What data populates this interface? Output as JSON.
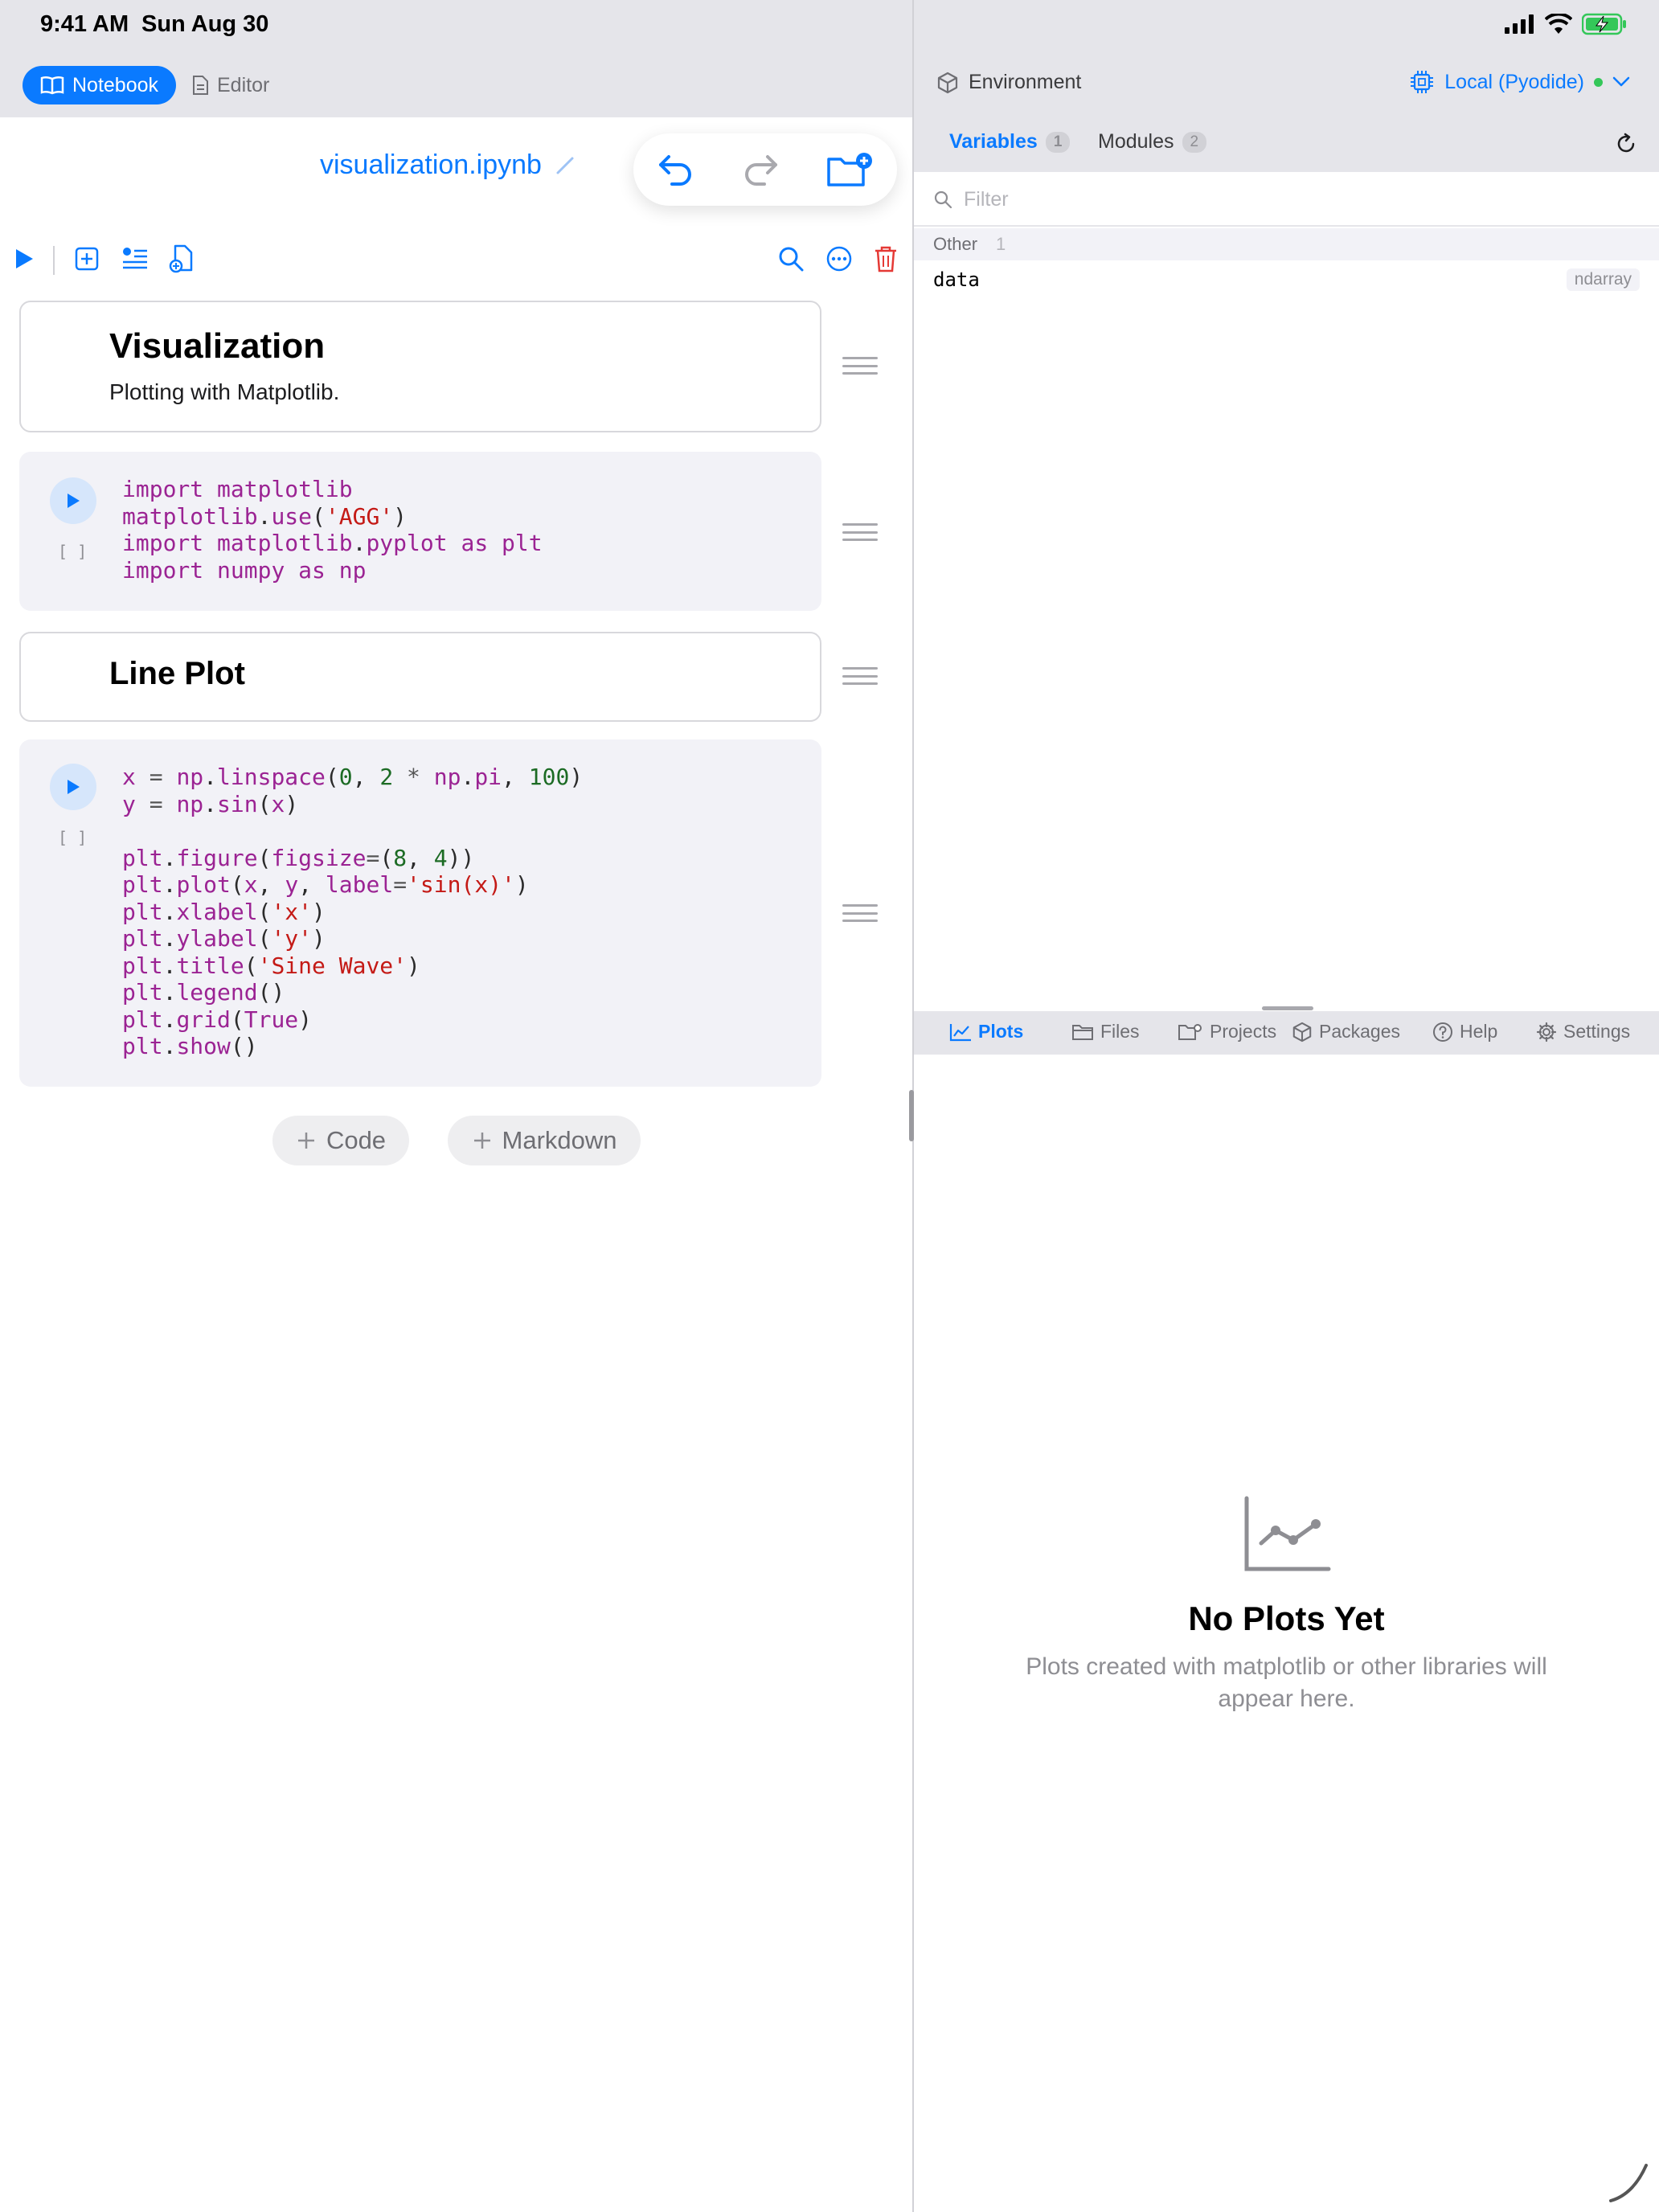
{
  "status_bar": {
    "time": "9:41 AM",
    "date": "Sun Aug 30"
  },
  "left_header": {
    "notebook_label": "Notebook",
    "editor_label": "Editor"
  },
  "notebook": {
    "filename": "visualization.ipynb"
  },
  "cells": {
    "md1": {
      "heading": "Visualization",
      "text": "Plotting with Matplotlib."
    },
    "code1": {
      "exec": "[ ]"
    },
    "md2": {
      "heading": "Line Plot"
    },
    "code2": {
      "exec": "[ ]"
    }
  },
  "add_buttons": {
    "code": "Code",
    "markdown": "Markdown"
  },
  "environment": {
    "label": "Environment",
    "runtime": "Local (Pyodide)",
    "tabs": [
      {
        "label": "Variables",
        "count": "1"
      },
      {
        "label": "Modules",
        "count": "2"
      }
    ],
    "filter_placeholder": "Filter",
    "group": {
      "name": "Other",
      "count": "1"
    },
    "variables": [
      {
        "name": "data",
        "type": "ndarray"
      }
    ]
  },
  "bottom_tabs": [
    {
      "label": "Plots",
      "icon": "line-chart-icon"
    },
    {
      "label": "Files",
      "icon": "folder-icon"
    },
    {
      "label": "Projects",
      "icon": "folder-settings-icon"
    },
    {
      "label": "Packages",
      "icon": "cube-icon"
    },
    {
      "label": "Help",
      "icon": "question-circle-icon"
    },
    {
      "label": "Settings",
      "icon": "gear-icon"
    }
  ],
  "plots_panel": {
    "title": "No Plots Yet",
    "subtitle": "Plots created with matplotlib or other libraries will appear here."
  },
  "colors": {
    "accent": "#0a7aff",
    "delete": "#e53935",
    "battery": "#34c759"
  }
}
